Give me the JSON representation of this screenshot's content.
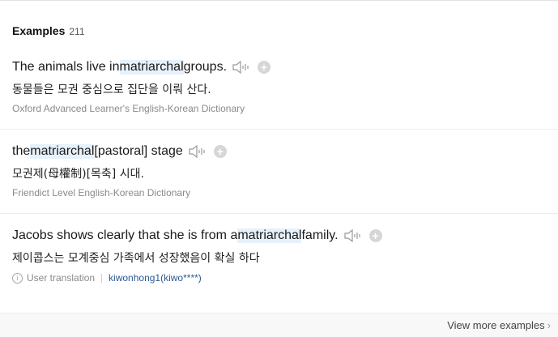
{
  "header": {
    "title": "Examples",
    "count": "211"
  },
  "examples": [
    {
      "en_before": "The animals live in ",
      "en_highlight": "matriarchal",
      "en_after": " groups.",
      "ko": "동물들은 모권 중심으로 집단을 이뤄 산다.",
      "source": "Oxford Advanced Learner's English-Korean Dictionary"
    },
    {
      "en_before": "the ",
      "en_highlight": "matriarchal",
      "en_after": "[pastoral] stage",
      "ko": "모권제(母權制)[목축] 시대.",
      "source": "Friendict Level English-Korean Dictionary"
    },
    {
      "en_before": "Jacobs shows clearly that she is from a ",
      "en_highlight": "matriarchal",
      "en_after": " family.",
      "ko": "제이콥스는 모계중심 가족에서 성장했음이 확실 하다",
      "user_label": "User translation",
      "user_name": "kiwonhong1(kiwo****)"
    }
  ],
  "footer": {
    "more_label": "View more examples"
  },
  "icons": {
    "speaker": "speaker-icon",
    "add": "plus-icon",
    "info": "info-icon",
    "chevron": "chevron-right-icon"
  },
  "colors": {
    "highlight": "#e6f1fb",
    "user_link": "#2e5a92"
  }
}
